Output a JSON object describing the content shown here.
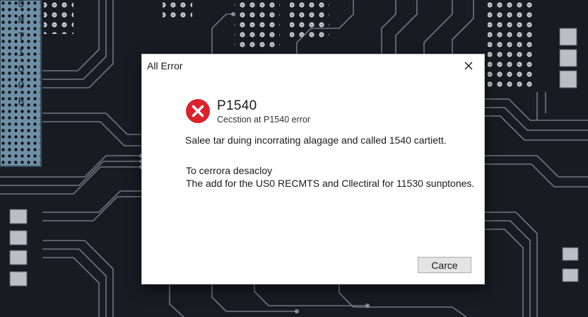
{
  "background": {
    "side_label": "OMTIOOB"
  },
  "dialog": {
    "title": "All Error",
    "close_icon": "close-icon",
    "status_icon": "error-icon",
    "heading": "P1540",
    "subheading": "Cecstion at P1540 error",
    "message": "Salee tar duing incorrating alagage and called 1540 cartiett.",
    "detail_line1": "To cerrora desacloy",
    "detail_line2": "The add for the US0 RECMTS and Cllectiral for 11530 sunptones.",
    "cancel_label": "Carce"
  },
  "colors": {
    "error_red": "#d9222a",
    "board_dark": "#151b21",
    "board_blue": "#6f8fa6"
  }
}
